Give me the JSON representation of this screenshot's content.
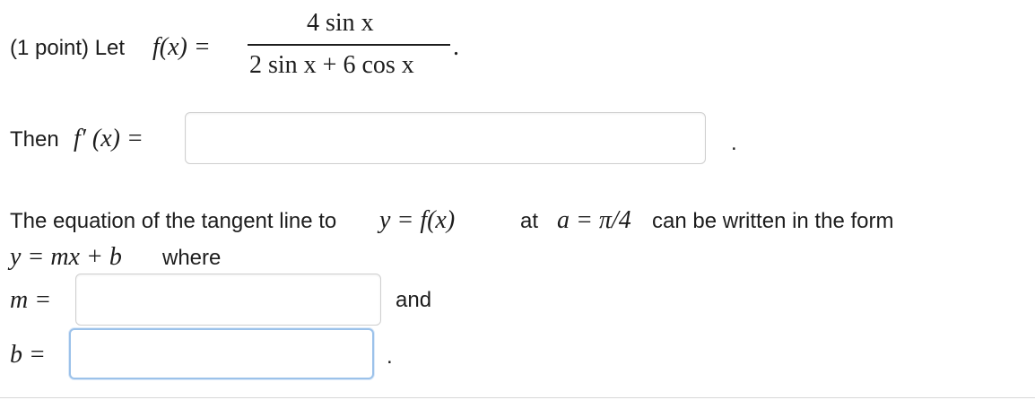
{
  "problem": {
    "points_label": "(1 point) Let",
    "function_lhs": "f(x) =",
    "numerator": "4 sin x",
    "denominator": "2 sin x + 6 cos x",
    "period": "."
  },
  "derivative": {
    "prompt_then": "Then",
    "prompt_math": "f′ (x) =",
    "answer_value": "",
    "period": "."
  },
  "tangent": {
    "line1_text_a": "The equation of the tangent line to",
    "line1_math_a": "y = f(x)",
    "line1_text_b": "at",
    "line1_math_b": "a = π/4",
    "line1_text_c": "can be written in the form",
    "line2_math": "y = mx + b",
    "line2_text": "where"
  },
  "slope": {
    "label": "m =",
    "answer_value": "",
    "suffix": "and"
  },
  "intercept": {
    "label": "b =",
    "answer_value": "",
    "period": "."
  }
}
